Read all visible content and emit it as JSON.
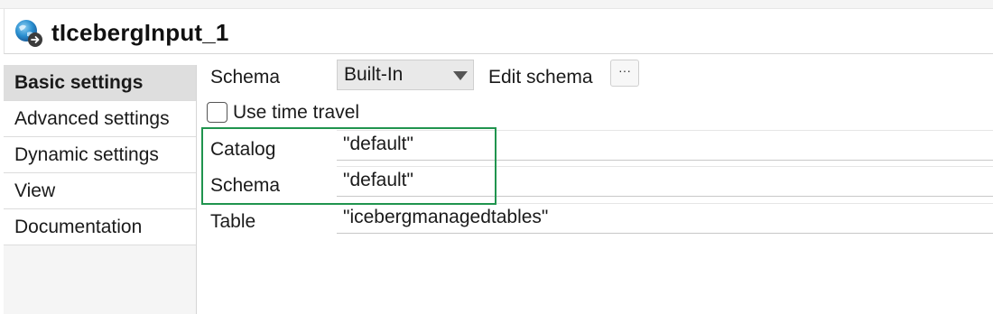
{
  "component": {
    "title": "tIcebergInput_1",
    "icon": "iceberg-component-icon"
  },
  "sidebar": {
    "items": [
      {
        "label": "Basic settings",
        "active": true
      },
      {
        "label": "Advanced settings",
        "active": false
      },
      {
        "label": "Dynamic settings",
        "active": false
      },
      {
        "label": "View",
        "active": false
      },
      {
        "label": "Documentation",
        "active": false
      }
    ]
  },
  "basic": {
    "schema_label": "Schema",
    "schema_value": "Built-In",
    "edit_schema_label": "Edit schema",
    "edit_schema_button": "···",
    "time_travel_label": "Use time travel",
    "time_travel_checked": false,
    "catalog_label": "Catalog",
    "catalog_value": "\"default\"",
    "schema_name_label": "Schema",
    "schema_name_value": "\"default\"",
    "table_label": "Table",
    "table_value": "\"icebergmanagedtables\""
  },
  "colors": {
    "highlight": "#20944e",
    "active_tab": "#dedede"
  }
}
